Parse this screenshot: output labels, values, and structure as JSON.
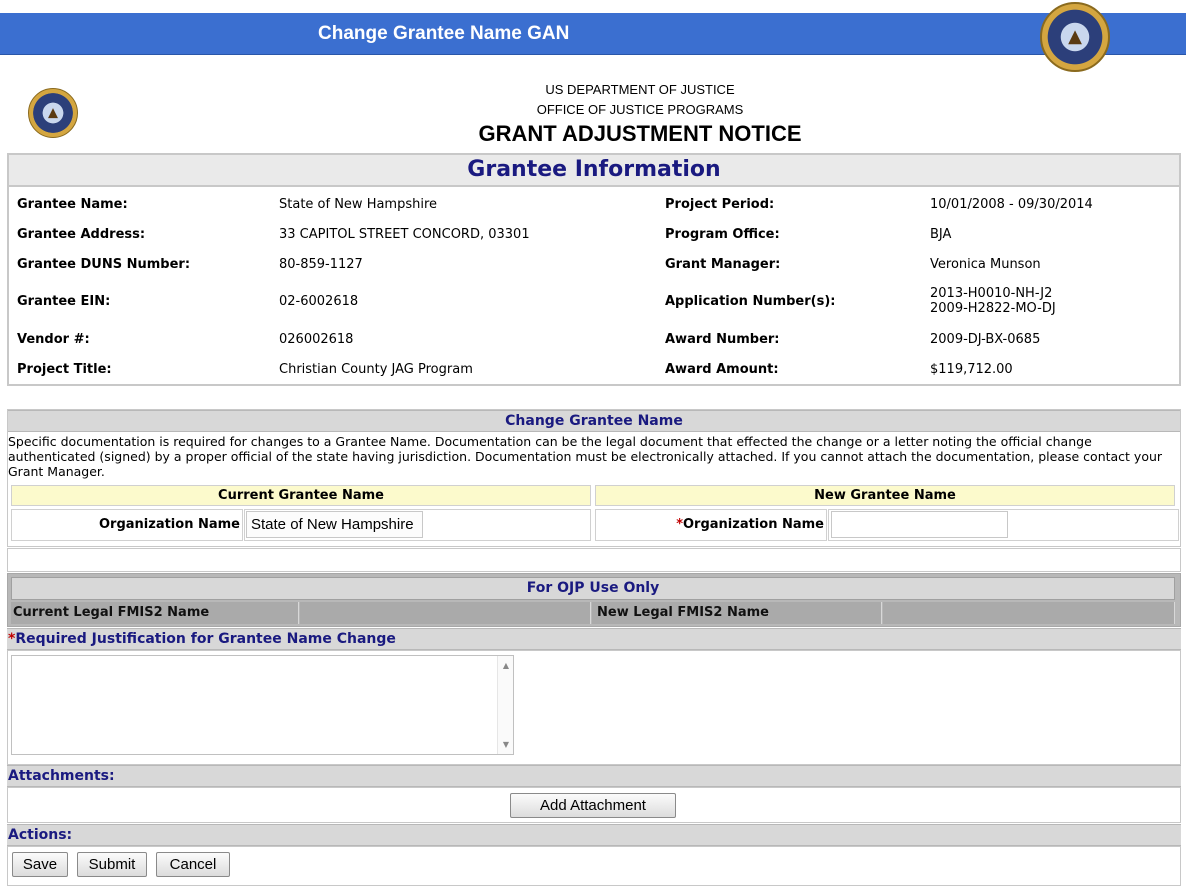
{
  "window": {
    "title": "Change Grantee Name GAN"
  },
  "header": {
    "dept": "US DEPARTMENT OF JUSTICE",
    "office": "OFFICE OF JUSTICE PROGRAMS",
    "notice": "GRANT ADJUSTMENT NOTICE"
  },
  "grantee_info": {
    "heading": "Grantee Information",
    "left": [
      {
        "label": "Grantee Name:",
        "value": "State of New Hampshire"
      },
      {
        "label": "Grantee Address:",
        "value": "33 CAPITOL STREET CONCORD, 03301"
      },
      {
        "label": "Grantee DUNS Number:",
        "value": "80-859-1127"
      },
      {
        "label": "Grantee EIN:",
        "value": "02-6002618"
      },
      {
        "label": "Vendor #:",
        "value": "026002618"
      },
      {
        "label": "Project Title:",
        "value": "Christian County JAG Program"
      }
    ],
    "right": [
      {
        "label": "Project Period:",
        "value": "10/01/2008 - 09/30/2014"
      },
      {
        "label": "Program Office:",
        "value": "BJA"
      },
      {
        "label": "Grant Manager:",
        "value": "Veronica Munson"
      },
      {
        "label": "Application Number(s):",
        "value1": "2013-H0010-NH-J2",
        "value2": "2009-H2822-MO-DJ"
      },
      {
        "label": "Award Number:",
        "value": "2009-DJ-BX-0685"
      },
      {
        "label": "Award Amount:",
        "value": "$119,712.00"
      }
    ]
  },
  "change_name": {
    "heading": "Change Grantee Name",
    "description": "Specific documentation is required for changes to a Grantee Name. Documentation can be the legal document that effected the change or a letter noting the official change authenticated (signed) by a proper official of the state having jurisdiction. Documentation must be electronically attached. If you cannot attach the documentation, please contact your Grant Manager.",
    "current_header": "Current Grantee Name",
    "new_header": "New Grantee Name",
    "org_label": "Organization Name",
    "required_mark": "*",
    "current_value": "State of New Hampshire",
    "new_value": ""
  },
  "ojp": {
    "heading": "For OJP Use Only",
    "current_label": "Current Legal FMIS2 Name",
    "new_label": "New Legal FMIS2 Name"
  },
  "justification": {
    "required_mark": "*",
    "label": "Required Justification for Grantee Name Change",
    "value": ""
  },
  "attachments": {
    "label": "Attachments:",
    "button": "Add Attachment"
  },
  "actions": {
    "label": "Actions:",
    "save": "Save",
    "submit": "Submit",
    "cancel": "Cancel"
  },
  "colors": {
    "title_bar": "#3b6fd0",
    "section_text": "#1a1a80",
    "highlight": "#fcfacc",
    "required": "#c00000"
  }
}
